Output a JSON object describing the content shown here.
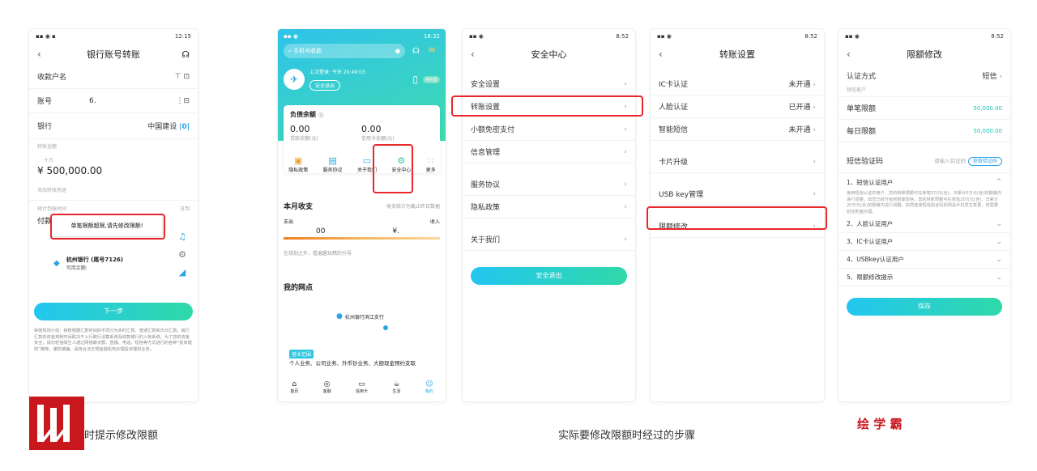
{
  "p1": {
    "status": "12:15",
    "title": "银行账号转账",
    "payee_label": "收款户名",
    "account_label": "账号",
    "account_value": "6.",
    "bank_label": "银行",
    "bank_value": "中国建设",
    "amount_label": "转账金额",
    "amount_unit": "十万",
    "amount_value": "¥ 500,000.00",
    "remark_label": "添加转账用途",
    "est_label": "预计到账时间",
    "est_value": "日到",
    "pay_label": "付款卡",
    "error_msg": "单笔限额超限,请先修改限额!",
    "card_name": "杭州银行 (尾号7126)",
    "card_balance": "可用余额:",
    "next_btn": "下一步",
    "notes": "转账规则介绍：转账根据汇款时间的不同分为实时汇款、普通汇款和次日汇款。跨行汇款的资金到账时间取决于入行跨行清算系统及收款银行的入账系统。为了您的资金安全，请勿轻信陌生人通过网络聊天群、直播、电话、短信等方式进行的各种“投资理财”推荐，谨防被骗。请将合法正规金融机构办理投资理财业务。",
    "caption": "时提示修改限额"
  },
  "p2": {
    "status": "18:32",
    "search_placeholder": "手机号收款",
    "last_login": "上次登录: 今天 20:49:03",
    "safe_exit": "安全退出",
    "badge": "待完善",
    "balance_title": "负债余额",
    "bal1": "0.00",
    "bal1_label": "贷款余额(元)",
    "bal2": "0.00",
    "bal2_label": "信用卡余额(元)",
    "icons": [
      "隐私政策",
      "服务协议",
      "关于我们",
      "安全中心",
      "更多"
    ],
    "month_title": "本月收支",
    "month_note": "收支统计为截止昨日数据",
    "out_label": "支出",
    "in_label": "收入",
    "out_value": "00",
    "in_value": "¥.",
    "tip": "在规划之外，看遍趣玩精的引导",
    "outlets_title": "我的网点",
    "branch": "杭州银行滨江支行",
    "scope_tag": "营业范围",
    "scope_text": "个人业务、公司业务、外币钞业务、大额现金预约支取",
    "tabs": [
      "首页",
      "金融",
      "信用卡",
      "生活",
      "我的"
    ]
  },
  "p3": {
    "status": "8:52",
    "title": "安全中心",
    "items": [
      "安全设置",
      "转账设置",
      "小额免密支付",
      "信息管理",
      "服务协议",
      "隐私政策",
      "关于我们"
    ],
    "exit_btn": "安全退出"
  },
  "p4": {
    "status": "8:52",
    "title": "转账设置",
    "items": [
      {
        "label": "IC卡认证",
        "value": "未开通"
      },
      {
        "label": "人脸认证",
        "value": "已开通"
      },
      {
        "label": "智能短信",
        "value": "未开通"
      },
      {
        "label": "卡片升级",
        "value": ""
      },
      {
        "label": "USB key管理",
        "value": ""
      },
      {
        "label": "限额修改",
        "value": ""
      }
    ]
  },
  "p5": {
    "status": "8:52",
    "title": "限额修改",
    "auth_label": "认证方式",
    "auth_value": "短信",
    "sub_label": "短信客户",
    "single_label": "单笔限额",
    "single_value": "50,000.00",
    "daily_label": "每日限额",
    "daily_value": "50,000.00",
    "sms_label": "短信验证码",
    "sms_placeholder": "请输入验证码",
    "sms_btn": "获取验证码",
    "sections": [
      "1、短信认证用户",
      "2、人脸认证用户",
      "3、IC卡认证用户",
      "4、USBkey认证用户",
      "5、限额修改提示"
    ],
    "section1_text": "使用短信认证的用户，您的转账限额可在单笔5万元(含)、日累计5万元(含)的额度内进行调整。如您已经升级到智能短信，您的转账限额可在单笔20万元(含)、日累计20万元(含)的额度内进行调整。如您能收短信验证码的则是手机发生变更，您需要前往柜面办理。",
    "save_btn": "保存"
  },
  "bottom": {
    "caption": "实际要修改限额时经过的步骤",
    "brand": "绘 学 霸"
  },
  "colors": {
    "accent": "#2aa4e6",
    "red": "#e8262b",
    "teal": "#1fc4b4"
  }
}
